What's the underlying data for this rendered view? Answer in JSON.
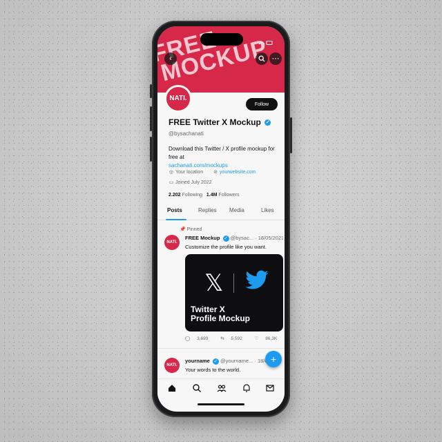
{
  "banner": {
    "line1": "FREE",
    "line2": "MOCKUP"
  },
  "profile": {
    "avatar_text": "NATI.",
    "follow_label": "Follow",
    "name": "FREE Twitter X Mockup",
    "handle": "@bysachanati",
    "bio_text": "Download this Twitter / X profile mockup for free at",
    "bio_link": "sachanati.com/mockups",
    "location": "Your location",
    "website": "yourwebsite.com",
    "joined": "Joined July 2022",
    "following_count": "2.202",
    "following_label": "Following",
    "followers_count": "1.4M",
    "followers_label": "Followers"
  },
  "tabs": [
    "Posts",
    "Replies",
    "Media",
    "Likes"
  ],
  "post1": {
    "pinned_label": "Pinned",
    "avatar_text": "NATI.",
    "name": "FREE Mockup",
    "handle": "@bysac...",
    "date": "· 18/05/2023",
    "text": "Customize the profile like you want.",
    "media_caption_1": "Twitter X",
    "media_caption_2": "Profile Mockup",
    "replies": "3,693",
    "reposts": "5,592",
    "likes": "86,3K"
  },
  "post2": {
    "avatar_text": "NATI.",
    "name": "yourname",
    "handle": "@yourname...",
    "date": "· 18/05/2",
    "text": "Your words to the world."
  },
  "fab_label": "+",
  "colors": {
    "brand_red": "#d6294a",
    "accent_blue": "#1d9bf0"
  },
  "icons": [
    "back-icon",
    "search-icon",
    "more-icon",
    "location-icon",
    "link-icon",
    "calendar-icon",
    "pin-icon",
    "reply-icon",
    "repost-icon",
    "like-icon",
    "stats-icon",
    "home-icon",
    "explore-icon",
    "communities-icon",
    "notifications-icon",
    "messages-icon"
  ]
}
